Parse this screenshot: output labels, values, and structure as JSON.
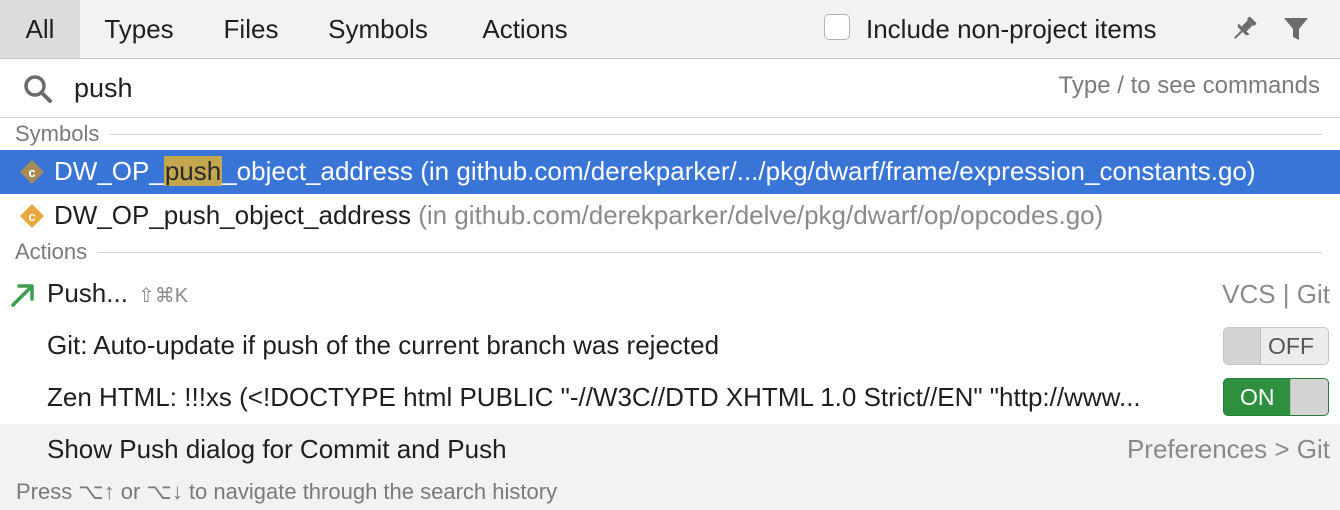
{
  "tabs": {
    "items": [
      {
        "label": "All",
        "active": true
      },
      {
        "label": "Types",
        "active": false
      },
      {
        "label": "Files",
        "active": false
      },
      {
        "label": "Symbols",
        "active": false
      },
      {
        "label": "Actions",
        "active": false
      }
    ],
    "include_non_project_label": "Include non-project items",
    "include_non_project_checked": false
  },
  "search": {
    "value": "push",
    "hint": "Type / to see commands"
  },
  "sections": {
    "symbols": "Symbols",
    "actions": "Actions"
  },
  "symbols": [
    {
      "name_before": "DW_OP_",
      "name_match": "push",
      "name_after": "_object_address",
      "location": "(in github.com/derekparker/.../pkg/dwarf/frame/expression_constants.go)",
      "icon": "class-icon",
      "selected": true
    },
    {
      "name": "DW_OP_push_object_address",
      "location": "(in github.com/derekparker/delve/pkg/dwarf/op/opcodes.go)",
      "icon": "class-icon",
      "selected": false
    }
  ],
  "actions": [
    {
      "label": "Push...",
      "shortcut": "⇧⌘K",
      "right": "VCS | Git",
      "icon": "push-arrow-icon"
    },
    {
      "label": "Git: Auto-update if push of the current branch was rejected",
      "toggle": "OFF"
    },
    {
      "label": "Zen HTML: !!!xs (<!DOCTYPE html PUBLIC \"-//W3C//DTD XHTML 1.0 Strict//EN\" \"http://www...",
      "toggle": "ON"
    },
    {
      "label": "Show Push dialog for Commit and Push",
      "right": "Preferences > Git"
    }
  ],
  "footer": "Press ⌥↑ or ⌥↓ to navigate through the search history",
  "colors": {
    "selection": "#3875d7",
    "match_highlight": "#c3a74f",
    "toggle_on": "#2e8f3e",
    "push_arrow": "#3c9e4b",
    "class_icon": "#e8a83a"
  }
}
